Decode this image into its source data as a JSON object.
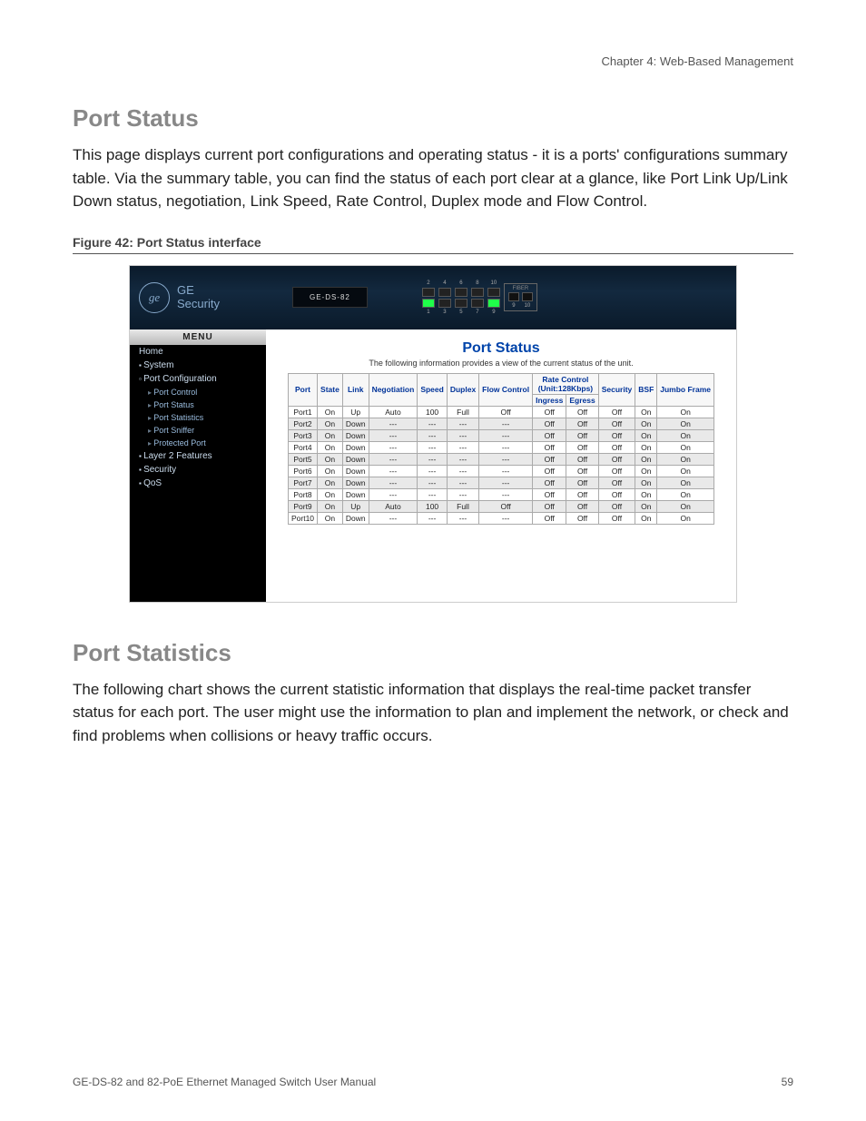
{
  "header": {
    "chapter": "Chapter 4: Web-Based Management"
  },
  "sections": {
    "portStatus": {
      "title": "Port Status",
      "body": "This page displays current port configurations and operating status - it is a ports' configurations summary table. Via the summary table, you can find the status of each port clear at a glance, like Port Link Up/Link Down status, negotiation, Link Speed, Rate Control, Duplex mode and Flow Control.",
      "figureCaption": "Figure 42:  Port Status interface"
    },
    "portStatistics": {
      "title": "Port Statistics",
      "body": "The following chart shows the current statistic information that displays the real-time packet transfer status for each port. The user might use the information to plan and implement the network, or check and find problems when collisions or heavy traffic occurs."
    }
  },
  "screenshot": {
    "brandTop": "GE",
    "brandBottom": "Security",
    "deviceModel": "GE-DS-82",
    "fiberLabel": "FIBER",
    "topPortNumbers": [
      "2",
      "4",
      "6",
      "8",
      "10"
    ],
    "bottomPortNumbers": [
      "1",
      "3",
      "5",
      "7",
      "9"
    ],
    "fiberPortNumbers": [
      "9",
      "10"
    ],
    "menuTitle": "MENU",
    "menu": [
      {
        "label": "Home",
        "type": "plain"
      },
      {
        "label": "System",
        "type": "closed"
      },
      {
        "label": "Port Configuration",
        "type": "open"
      },
      {
        "label": "Port Control",
        "type": "sub"
      },
      {
        "label": "Port Status",
        "type": "sub"
      },
      {
        "label": "Port Statistics",
        "type": "sub"
      },
      {
        "label": "Port Sniffer",
        "type": "sub"
      },
      {
        "label": "Protected Port",
        "type": "sub"
      },
      {
        "label": "Layer 2 Features",
        "type": "closed"
      },
      {
        "label": "Security",
        "type": "closed"
      },
      {
        "label": "QoS",
        "type": "closed"
      }
    ],
    "contentTitle": "Port Status",
    "contentSubtitle": "The following information provides a view of the current status of the unit.",
    "columns": {
      "port": "Port",
      "state": "State",
      "link": "Link",
      "negotiation": "Negotiation",
      "speed": "Speed",
      "duplex": "Duplex",
      "flow": "Flow Control",
      "rate": "Rate Control",
      "rateUnit": "(Unit:128Kbps)",
      "ingress": "Ingress",
      "egress": "Egress",
      "security": "Security",
      "bsf": "BSF",
      "jumbo": "Jumbo Frame"
    },
    "rows": [
      {
        "port": "Port1",
        "state": "On",
        "link": "Up",
        "neg": "Auto",
        "speed": "100",
        "duplex": "Full",
        "flow": "Off",
        "ingress": "Off",
        "egress": "Off",
        "sec": "Off",
        "bsf": "On",
        "jumbo": "On",
        "shade": false
      },
      {
        "port": "Port2",
        "state": "On",
        "link": "Down",
        "neg": "---",
        "speed": "---",
        "duplex": "---",
        "flow": "---",
        "ingress": "Off",
        "egress": "Off",
        "sec": "Off",
        "bsf": "On",
        "jumbo": "On",
        "shade": true
      },
      {
        "port": "Port3",
        "state": "On",
        "link": "Down",
        "neg": "---",
        "speed": "---",
        "duplex": "---",
        "flow": "---",
        "ingress": "Off",
        "egress": "Off",
        "sec": "Off",
        "bsf": "On",
        "jumbo": "On",
        "shade": true
      },
      {
        "port": "Port4",
        "state": "On",
        "link": "Down",
        "neg": "---",
        "speed": "---",
        "duplex": "---",
        "flow": "---",
        "ingress": "Off",
        "egress": "Off",
        "sec": "Off",
        "bsf": "On",
        "jumbo": "On",
        "shade": false
      },
      {
        "port": "Port5",
        "state": "On",
        "link": "Down",
        "neg": "---",
        "speed": "---",
        "duplex": "---",
        "flow": "---",
        "ingress": "Off",
        "egress": "Off",
        "sec": "Off",
        "bsf": "On",
        "jumbo": "On",
        "shade": true
      },
      {
        "port": "Port6",
        "state": "On",
        "link": "Down",
        "neg": "---",
        "speed": "---",
        "duplex": "---",
        "flow": "---",
        "ingress": "Off",
        "egress": "Off",
        "sec": "Off",
        "bsf": "On",
        "jumbo": "On",
        "shade": false
      },
      {
        "port": "Port7",
        "state": "On",
        "link": "Down",
        "neg": "---",
        "speed": "---",
        "duplex": "---",
        "flow": "---",
        "ingress": "Off",
        "egress": "Off",
        "sec": "Off",
        "bsf": "On",
        "jumbo": "On",
        "shade": true
      },
      {
        "port": "Port8",
        "state": "On",
        "link": "Down",
        "neg": "---",
        "speed": "---",
        "duplex": "---",
        "flow": "---",
        "ingress": "Off",
        "egress": "Off",
        "sec": "Off",
        "bsf": "On",
        "jumbo": "On",
        "shade": false
      },
      {
        "port": "Port9",
        "state": "On",
        "link": "Up",
        "neg": "Auto",
        "speed": "100",
        "duplex": "Full",
        "flow": "Off",
        "ingress": "Off",
        "egress": "Off",
        "sec": "Off",
        "bsf": "On",
        "jumbo": "On",
        "shade": true
      },
      {
        "port": "Port10",
        "state": "On",
        "link": "Down",
        "neg": "---",
        "speed": "---",
        "duplex": "---",
        "flow": "---",
        "ingress": "Off",
        "egress": "Off",
        "sec": "Off",
        "bsf": "On",
        "jumbo": "On",
        "shade": false
      }
    ]
  },
  "footer": {
    "left": "GE-DS-82 and 82-PoE Ethernet Managed Switch User Manual",
    "right": "59"
  }
}
